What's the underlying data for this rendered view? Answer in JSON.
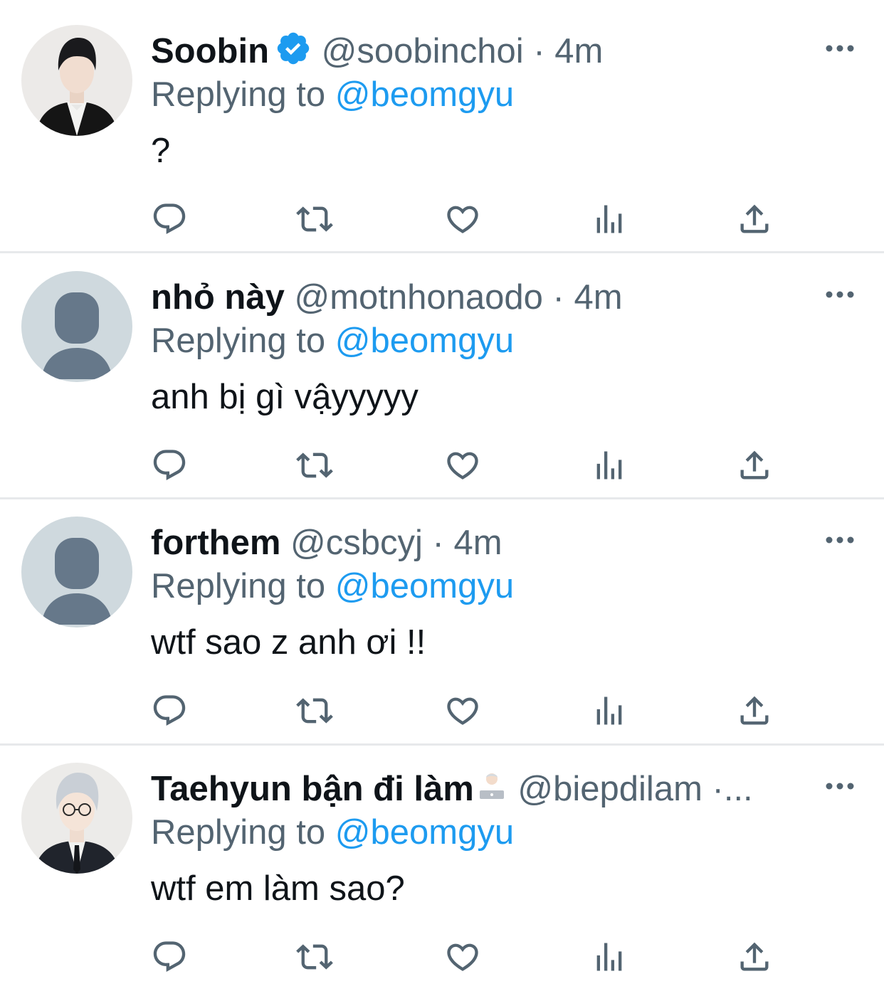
{
  "tweets": [
    {
      "name": "Soobin",
      "verified": true,
      "handle": "@soobinchoi",
      "separator": "·",
      "time": "4m",
      "replying_label": "Replying to",
      "replying_to": "@beomgyu",
      "text": "?",
      "avatar_type": "photo-tuxedo"
    },
    {
      "name": "nhỏ này",
      "verified": false,
      "handle": "@motnhonaodo",
      "separator": "·",
      "time": "4m",
      "replying_label": "Replying to",
      "replying_to": "@beomgyu",
      "text": "anh bị gì vậyyyyy",
      "avatar_type": "default-avatar"
    },
    {
      "name": "forthem",
      "verified": false,
      "handle": "@csbcyj",
      "separator": "·",
      "time": "4m",
      "replying_label": "Replying to",
      "replying_to": "@beomgyu",
      "text": "wtf sao z anh ơi !!",
      "avatar_type": "default-avatar"
    },
    {
      "name": "Taehyun bận đi làm",
      "name_emoji": "person-with-laptop-emoji",
      "verified": false,
      "handle": "@biepdilam",
      "separator": "·...",
      "time": "",
      "replying_label": "Replying to",
      "replying_to": "@beomgyu",
      "text": "wtf em làm sao?",
      "avatar_type": "photo-glasses"
    }
  ],
  "actions": [
    "reply-icon",
    "retweet-icon",
    "like-icon",
    "views-icon",
    "share-icon"
  ],
  "colors": {
    "accent": "#1d9bf0",
    "text": "#0f1419",
    "secondary": "#536471",
    "divider": "#e7e9eb",
    "default_avatar_bg": "#cfd9de",
    "default_avatar_fg": "#66788a"
  }
}
